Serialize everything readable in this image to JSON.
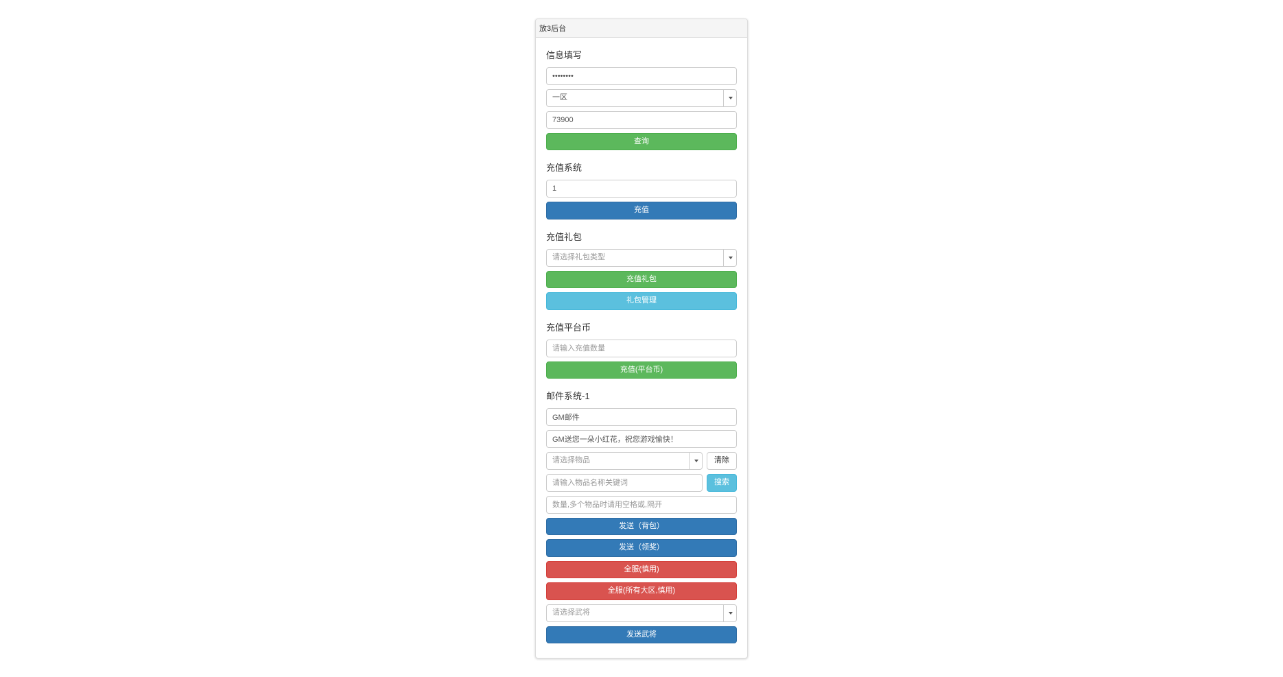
{
  "panel": {
    "title": "放3后台"
  },
  "info": {
    "title": "信息填写",
    "password_value": "••••••••",
    "zone_selected": "一区",
    "qq_value": "73900",
    "query_btn": "查询"
  },
  "recharge": {
    "title": "充值系统",
    "amount_value": "1",
    "recharge_btn": "充值"
  },
  "gift": {
    "title": "充值礼包",
    "select_placeholder": "请选择礼包类型",
    "recharge_gift_btn": "充值礼包",
    "gift_manage_btn": "礼包管理"
  },
  "platform": {
    "title": "充值平台币",
    "amount_placeholder": "请输入充值数量",
    "recharge_platform_btn": "充值(平台币)"
  },
  "mail": {
    "title": "邮件系统-1",
    "subject_value": "GM邮件",
    "content_value": "GM送您一朵小红花，祝您游戏愉快！",
    "item_select_placeholder": "请选择物品",
    "clear_btn": "清除",
    "item_search_placeholder": "请输入物品名称关键词",
    "search_btn": "搜索",
    "qty_placeholder": "数量,多个物品时请用空格或,隔开",
    "send_bag_btn": "发送（背包）",
    "send_reward_btn": "发送（领奖）",
    "all_server_btn": "全服(慎用)",
    "all_region_btn": "全服(所有大区,慎用)",
    "general_select_placeholder": "请选择武将",
    "send_general_btn": "发送武将"
  }
}
